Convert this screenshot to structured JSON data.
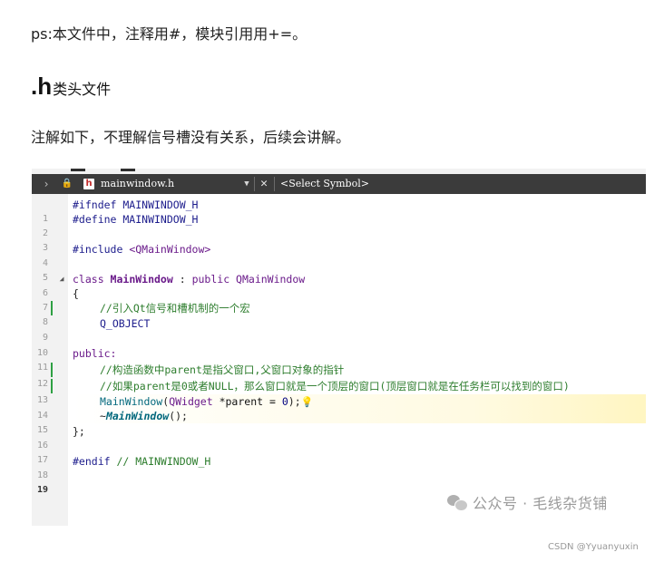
{
  "article": {
    "note_text": "ps:本文件中，注释用#，模块引用用+=。",
    "heading_dot_h": ".h",
    "heading_rest": "类头文件",
    "explain_text": "注解如下，不理解信号槽没有关系，后续会讲解。"
  },
  "editor": {
    "toolbar": {
      "back_icon": "chevron-left-icon",
      "lock_icon": "lock-icon",
      "file_icon_letter": "h",
      "file_name": "mainwindow.h",
      "dropdown_icon": "chevron-down-icon",
      "close_icon": "close-icon",
      "symbol_select": "<Select Symbol>"
    },
    "lines": [
      {
        "n": "1",
        "text": "#ifndef MAINWINDOW_H"
      },
      {
        "n": "2",
        "text": "#define MAINWINDOW_H"
      },
      {
        "n": "3",
        "text": ""
      },
      {
        "n": "4",
        "text_a": "#include ",
        "text_b": "<QMainWindow>"
      },
      {
        "n": "5",
        "text": ""
      },
      {
        "n": "6",
        "kw": "class ",
        "name": "MainWindow",
        "mid": " : ",
        "kw2": "public ",
        "base": "QMainWindow"
      },
      {
        "n": "7",
        "text": "{"
      },
      {
        "n": "8",
        "text": "//引入Qt信号和槽机制的一个宏"
      },
      {
        "n": "9",
        "text": "Q_OBJECT"
      },
      {
        "n": "10",
        "text": ""
      },
      {
        "n": "11",
        "text": "public:"
      },
      {
        "n": "12",
        "text": "//构造函数中parent是指父窗口,父窗口对象的指针"
      },
      {
        "n": "13",
        "text": "//如果parent是0或者NULL，那么窗口就是一个顶层的窗口(顶层窗口就是在任务栏可以找到的窗口)"
      },
      {
        "n": "14",
        "f": "MainWindow",
        "p1": "(",
        "t": "QWidget",
        "p2": " *parent = ",
        "num": "0",
        "p3": ");"
      },
      {
        "n": "15",
        "tilde": "~",
        "dtor": "MainWindow",
        "tail": "();"
      },
      {
        "n": "16",
        "text": "};"
      },
      {
        "n": "17",
        "text": ""
      },
      {
        "n": "18",
        "pre": "#endif",
        "cmt": " // MAINWINDOW_H"
      },
      {
        "n": "19",
        "text": ""
      }
    ],
    "watermark": "公众号 · 毛线杂货铺"
  },
  "footer": {
    "csdn_credit": "CSDN @Yyuanyuxin"
  },
  "colors": {
    "toolbar_bg": "#3b3b3b",
    "modified_bar": "#2ea043",
    "keyword": "#6a1a8a",
    "comment": "#2d7d2d",
    "preprocessor": "#1c1c8c"
  }
}
